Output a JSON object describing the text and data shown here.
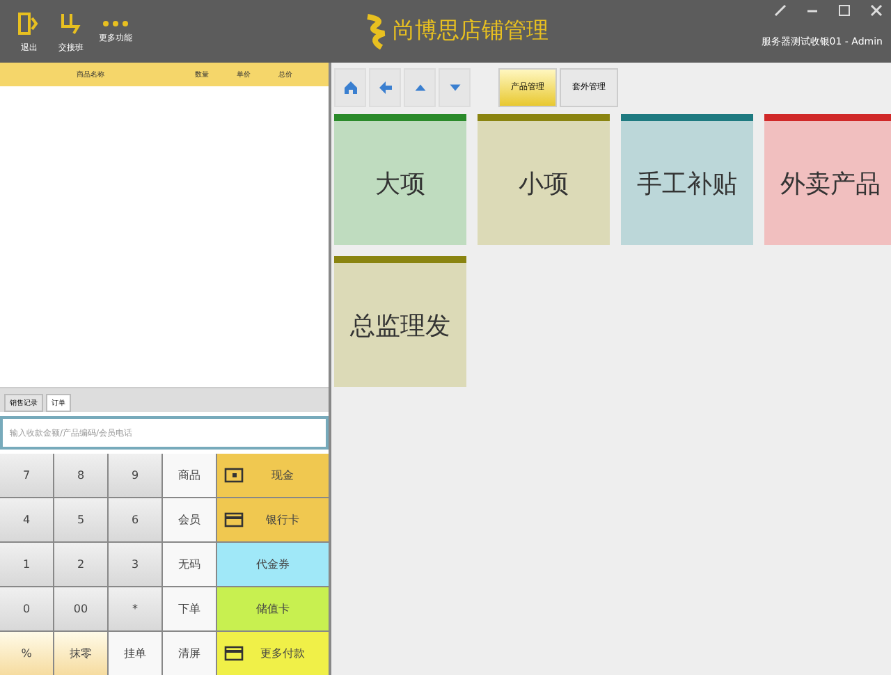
{
  "header": {
    "actions": [
      {
        "label": "退出",
        "kind": "exit"
      },
      {
        "label": "交接班",
        "kind": "shift"
      },
      {
        "label": "更多功能",
        "kind": "more"
      }
    ],
    "title": "尚博思店铺管理",
    "user": "服务器测试收银01 - Admin"
  },
  "order_table": {
    "columns": [
      "商品名称",
      "数量",
      "单价",
      "总价"
    ]
  },
  "tabs": [
    {
      "label": "销售记录",
      "selected": false
    },
    {
      "label": "订单",
      "selected": true
    }
  ],
  "search": {
    "placeholder": "输入收款金额/产品编码/会员电话"
  },
  "keypad": [
    {
      "label": "7",
      "kind": "digit"
    },
    {
      "label": "8",
      "kind": "digit"
    },
    {
      "label": "9",
      "kind": "digit"
    },
    {
      "label": "商品",
      "kind": "function"
    },
    {
      "label": "4",
      "kind": "digit"
    },
    {
      "label": "5",
      "kind": "digit"
    },
    {
      "label": "6",
      "kind": "digit"
    },
    {
      "label": "会员",
      "kind": "function"
    },
    {
      "label": "1",
      "kind": "digit"
    },
    {
      "label": "2",
      "kind": "digit"
    },
    {
      "label": "3",
      "kind": "digit"
    },
    {
      "label": "无码",
      "kind": "function"
    },
    {
      "label": "0",
      "kind": "digit"
    },
    {
      "label": "00",
      "kind": "digit"
    },
    {
      "label": "*",
      "kind": "digit"
    },
    {
      "label": "下单",
      "kind": "function"
    },
    {
      "label": "%",
      "kind": "special"
    },
    {
      "label": "抹零",
      "kind": "special"
    },
    {
      "label": "挂单",
      "kind": "function"
    },
    {
      "label": "清屏",
      "kind": "function"
    }
  ],
  "payments": [
    {
      "label": "现金",
      "kind": "cash",
      "color": "#f0c850"
    },
    {
      "label": "银行卡",
      "kind": "card",
      "color": "#f0c850"
    },
    {
      "label": "代金券",
      "kind": "plain",
      "color": "#a0e8f8"
    },
    {
      "label": "储值卡",
      "kind": "plain",
      "color": "#c8f050"
    },
    {
      "label": "更多付款",
      "kind": "card",
      "color": "#f0f048"
    }
  ],
  "toolbar": {
    "nav": [
      {
        "kind": "home"
      },
      {
        "kind": "back"
      },
      {
        "kind": "up"
      },
      {
        "kind": "down"
      }
    ],
    "tabs": [
      {
        "label": "产品管理",
        "selected": true
      },
      {
        "label": "套外管理",
        "selected": false
      }
    ]
  },
  "categories": [
    {
      "label": "大项",
      "color": "#2a8a2a"
    },
    {
      "label": "小项",
      "color": "#8a8410"
    },
    {
      "label": "手工补贴",
      "color": "#1e7a80"
    },
    {
      "label": "外卖产品",
      "color": "#d02828"
    },
    {
      "label": "总监理发",
      "color": "#8a8410"
    }
  ]
}
